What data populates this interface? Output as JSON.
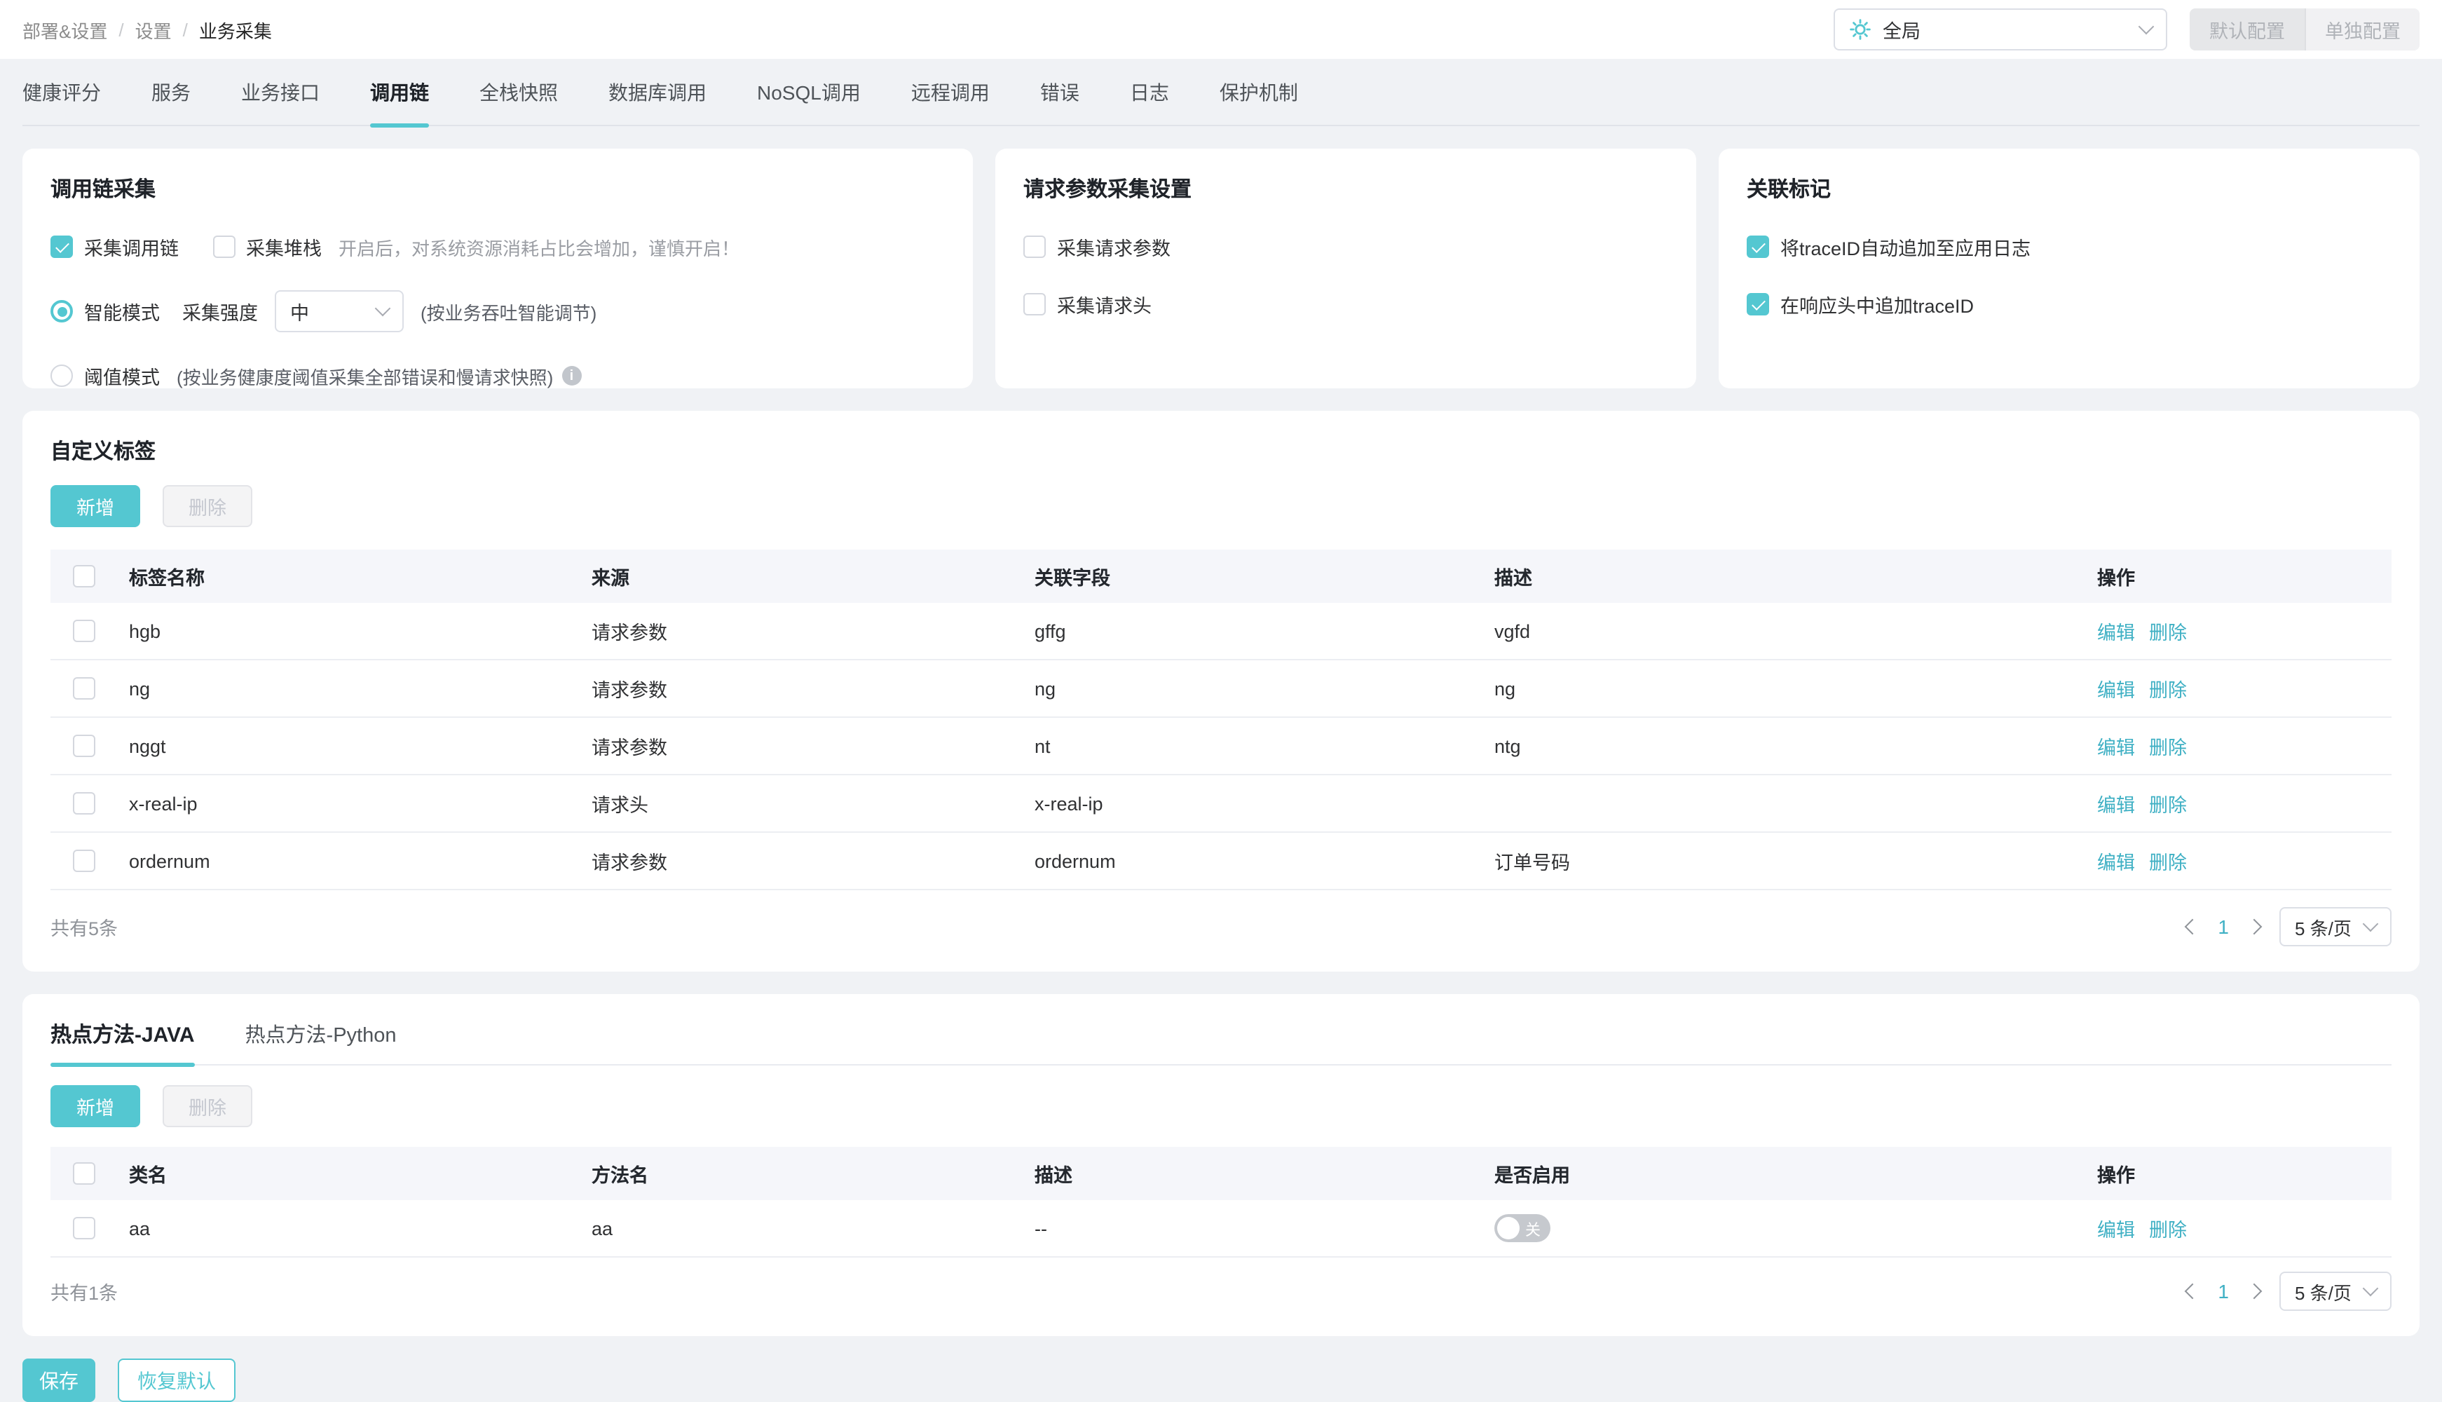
{
  "breadcrumb": {
    "items": [
      "部署&设置",
      "设置",
      "业务采集"
    ],
    "separator": "/"
  },
  "header": {
    "scope": {
      "value": "全局",
      "icon": "gear-icon"
    },
    "buttons": {
      "default_label": "默认配置",
      "separate_label": "单独配置"
    }
  },
  "tabs": {
    "items": [
      "健康评分",
      "服务",
      "业务接口",
      "调用链",
      "全栈快照",
      "数据库调用",
      "NoSQL调用",
      "远程调用",
      "错误",
      "日志",
      "保护机制"
    ],
    "active": "调用链"
  },
  "colors": {
    "accent": "#54c7d1",
    "link": "#3fb0c4",
    "page_bg": "#f0f2f5"
  },
  "cards": {
    "trace": {
      "title": "调用链采集",
      "collect_trace": "采集调用链",
      "collect_trace_checked": true,
      "collect_stack": "采集堆栈",
      "collect_stack_checked": false,
      "stack_hint": "开启后，对系统资源消耗占比会增加，谨慎开启！",
      "smart_mode": "智能模式",
      "smart_mode_selected": true,
      "intensity_label": "采集强度",
      "intensity_value": "中",
      "smart_hint": "(按业务吞吐智能调节)",
      "threshold_mode": "阈值模式",
      "threshold_mode_selected": false,
      "threshold_hint": "(按业务健康度阈值采集全部错误和慢请求快照)"
    },
    "request": {
      "title": "请求参数采集设置",
      "collect_params": "采集请求参数",
      "collect_params_checked": false,
      "collect_headers": "采集请求头",
      "collect_headers_checked": false
    },
    "marking": {
      "title": "关联标记",
      "append_log": "将traceID自动追加至应用日志",
      "append_log_checked": true,
      "append_header": "在响应头中追加traceID",
      "append_header_checked": true
    }
  },
  "custom_tags": {
    "title": "自定义标签",
    "add_label": "新增",
    "delete_label": "删除",
    "columns": [
      "标签名称",
      "来源",
      "关联字段",
      "描述",
      "操作"
    ],
    "rows": [
      {
        "name": "hgb",
        "source": "请求参数",
        "field": "gffg",
        "desc": "vgfd"
      },
      {
        "name": "ng",
        "source": "请求参数",
        "field": "ng",
        "desc": "ng"
      },
      {
        "name": "nggt",
        "source": "请求参数",
        "field": "nt",
        "desc": "ntg"
      },
      {
        "name": "x-real-ip",
        "source": "请求头",
        "field": "x-real-ip",
        "desc": ""
      },
      {
        "name": "ordernum",
        "source": "请求参数",
        "field": "ordernum",
        "desc": "订单号码"
      }
    ],
    "edit_label": "编辑",
    "remove_label": "删除",
    "footer": {
      "total": "共有5条",
      "page": "1",
      "page_size": "5 条/页"
    }
  },
  "hot": {
    "tabs": [
      "热点方法-JAVA",
      "热点方法-Python"
    ],
    "active": "热点方法-JAVA",
    "add_label": "新增",
    "delete_label": "删除",
    "columns": [
      "类名",
      "方法名",
      "描述",
      "是否启用",
      "操作"
    ],
    "rows": [
      {
        "class_name": "aa",
        "method": "aa",
        "desc": "--",
        "enabled": false,
        "toggle_label": "关"
      }
    ],
    "edit_label": "编辑",
    "remove_label": "删除",
    "footer": {
      "total": "共有1条",
      "page": "1",
      "page_size": "5 条/页"
    }
  },
  "actions": {
    "save": "保存",
    "reset": "恢复默认"
  }
}
